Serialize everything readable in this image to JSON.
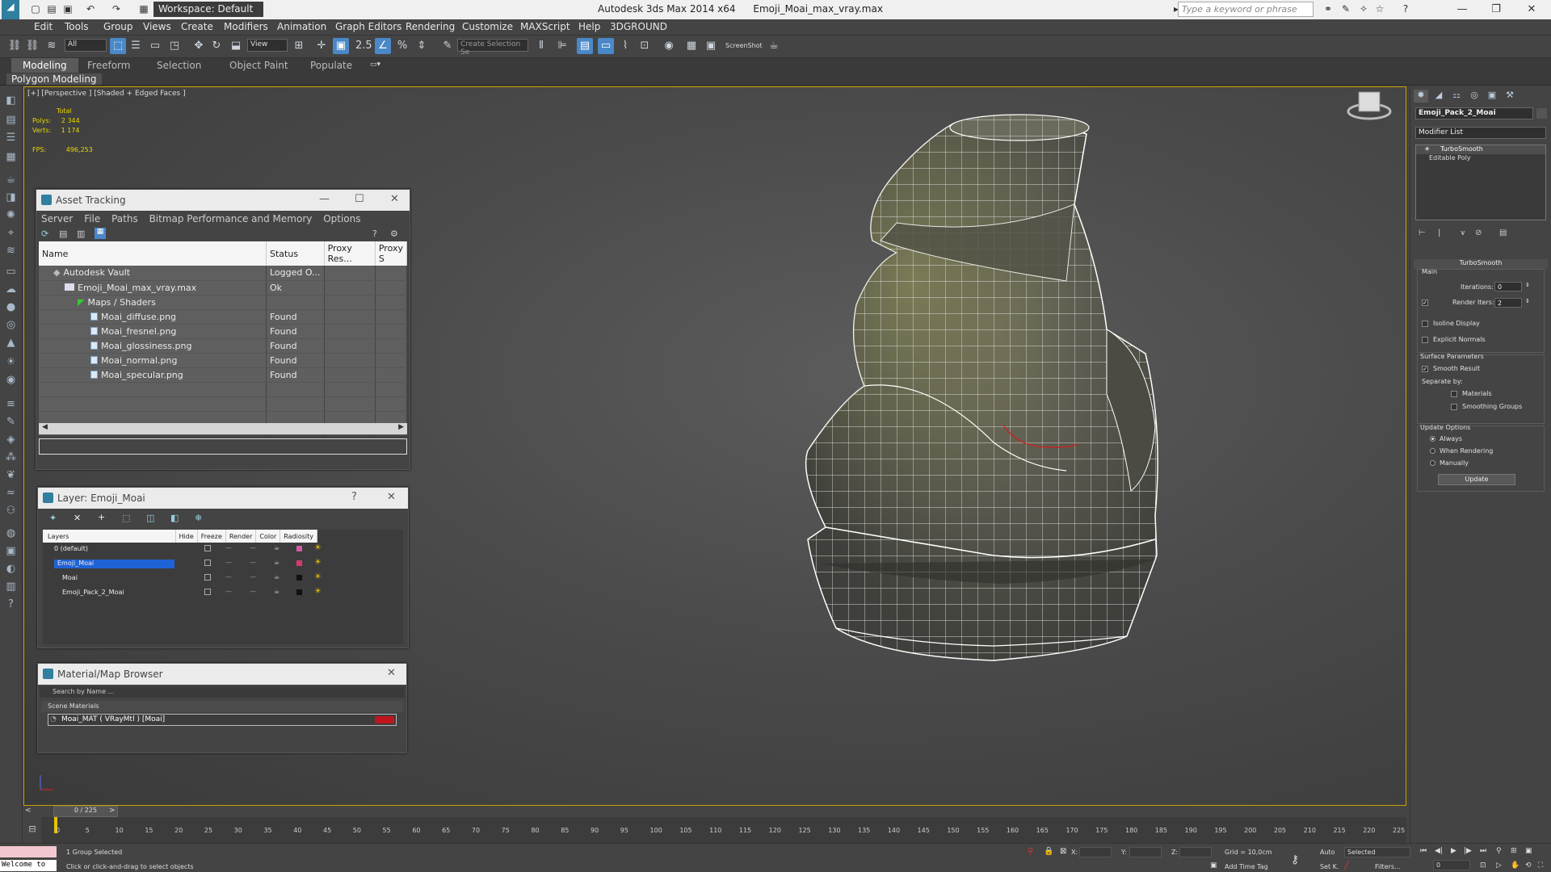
{
  "window": {
    "app_title": "Autodesk 3ds Max  2014 x64",
    "file_title": "Emoji_Moai_max_vray.max",
    "workspace": "Workspace: Default",
    "search_placeholder": "Type a keyword or phrase"
  },
  "menu": [
    "Edit",
    "Tools",
    "Group",
    "Views",
    "Create",
    "Modifiers",
    "Animation",
    "Graph Editors",
    "Rendering",
    "Customize",
    "MAXScript",
    "Help",
    "3DGROUND"
  ],
  "toolbar": {
    "filter_value": "All",
    "refcoord_value": "View",
    "selection_set_placeholder": "Create Selection Se",
    "screenshot_label": "ScreenShot"
  },
  "ribbon": {
    "tabs": [
      "Modeling",
      "Freeform",
      "Selection",
      "Object Paint",
      "Populate"
    ],
    "active_tab": "Modeling",
    "sub_label": "Polygon Modeling"
  },
  "viewport": {
    "label": "[+] [Perspective ] [Shaded + Edged Faces ]",
    "stats_total": "Total",
    "polys_label": "Polys:",
    "polys_value": "2 344",
    "verts_label": "Verts:",
    "verts_value": "1 174",
    "fps_label": "FPS:",
    "fps_value": "496,253"
  },
  "asset_tracking": {
    "title": "Asset Tracking",
    "menu": [
      "Server",
      "File",
      "Paths",
      "Bitmap Performance and Memory",
      "Options"
    ],
    "columns": [
      "Name",
      "Status",
      "Proxy Res...",
      "Proxy S"
    ],
    "rows": [
      {
        "name": "Autodesk Vault",
        "status": "Logged O..."
      },
      {
        "name": "Emoji_Moai_max_vray.max",
        "status": "Ok"
      },
      {
        "name": "Maps / Shaders",
        "status": ""
      },
      {
        "name": "Moai_diffuse.png",
        "status": "Found"
      },
      {
        "name": "Moai_fresnel.png",
        "status": "Found"
      },
      {
        "name": "Moai_glossiness.png",
        "status": "Found"
      },
      {
        "name": "Moai_normal.png",
        "status": "Found"
      },
      {
        "name": "Moai_specular.png",
        "status": "Found"
      }
    ]
  },
  "layer_dialog": {
    "title": "Layer: Emoji_Moai",
    "columns": [
      "Layers",
      "Hide",
      "Freeze",
      "Render",
      "Color",
      "Radiosity"
    ],
    "rows": [
      {
        "name": "0 (default)",
        "color": "#d45aa8"
      },
      {
        "name": "Emoji_Moai",
        "color": "#d43a6a"
      },
      {
        "name": "Moai",
        "color": "#111111"
      },
      {
        "name": "Emoji_Pack_2_Moai",
        "color": "#111111"
      }
    ]
  },
  "material_browser": {
    "title": "Material/Map Browser",
    "search_placeholder": "Search by Name ...",
    "section": "Scene Materials",
    "item": "Moai_MAT ( VRayMtl ) [Moai]",
    "swatch_color": "#c0141e"
  },
  "command_panel": {
    "object_name": "Emoji_Pack_2_Moai",
    "modifier_list": "Modifier List",
    "stack": [
      "TurboSmooth",
      "Editable Poly"
    ],
    "rollout_title": "TurboSmooth",
    "main_label": "Main",
    "iterations_label": "Iterations:",
    "iterations_value": "0",
    "render_iters_label": "Render Iters:",
    "render_iters_value": "2",
    "isoline": "Isoline Display",
    "explicit": "Explicit Normals",
    "surface_params": "Surface Parameters",
    "smooth_result": "Smooth Result",
    "separate_by": "Separate by:",
    "materials": "Materials",
    "smoothing_groups": "Smoothing Groups",
    "update_options": "Update Options",
    "always": "Always",
    "when_rendering": "When Rendering",
    "manually": "Manually",
    "update_button": "Update"
  },
  "timeline": {
    "frame_display": "0 / 225",
    "ticks": [
      "0",
      "5",
      "10",
      "15",
      "20",
      "25",
      "30",
      "35",
      "40",
      "45",
      "50",
      "55",
      "60",
      "65",
      "70",
      "75",
      "80",
      "85",
      "90",
      "95",
      "100",
      "105",
      "110",
      "115",
      "120",
      "125",
      "130",
      "135",
      "140",
      "145",
      "150",
      "155",
      "160",
      "165",
      "170",
      "175",
      "180",
      "185",
      "190",
      "195",
      "200",
      "205",
      "210",
      "215",
      "220",
      "225"
    ]
  },
  "status": {
    "maxscript": "Welcome to",
    "selection": "1 Group Selected",
    "prompt": "Click or click-and-drag to select objects",
    "x_label": "X:",
    "y_label": "Y:",
    "z_label": "Z:",
    "grid": "Grid = 10,0cm",
    "add_time_tag": "Add Time Tag",
    "auto": "Auto",
    "selected": "Selected",
    "setk": "Set K.",
    "filters": "Filters...",
    "frame_value": "0"
  }
}
